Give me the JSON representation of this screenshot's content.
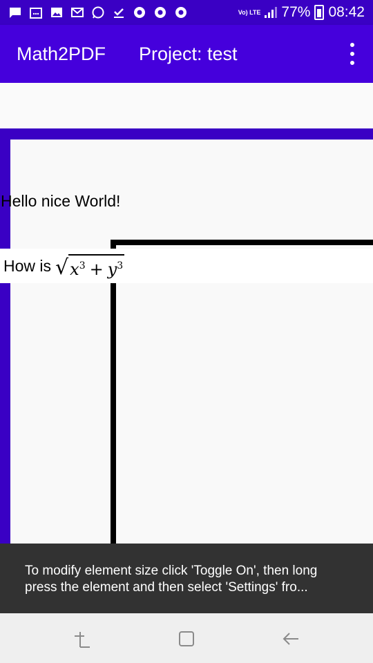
{
  "status_bar": {
    "network_label": "Vo) LTE",
    "battery_percent": "77%",
    "time": "08:42",
    "icons": [
      "chat-icon",
      "calendar-icon",
      "image-icon",
      "gmail-icon",
      "whatsapp-icon",
      "download-done-icon",
      "chrome-icon",
      "chrome-icon",
      "chrome-icon"
    ]
  },
  "app_bar": {
    "app_name": "Math2PDF",
    "project_title": "Project: test",
    "menu_icon": "more-vert-icon"
  },
  "canvas": {
    "text_element": "Hello nice World!",
    "math_element": {
      "prefix": "How is",
      "latex": "\\sqrt{x^3 + y^3}",
      "base1": "x",
      "exp1": "3",
      "op": "+",
      "base2": "y",
      "exp2": "3"
    }
  },
  "snackbar": {
    "message": "To modify element size click 'Toggle On', then long press the  element and then select 'Settings' fro..."
  },
  "nav_bar": {
    "buttons": [
      "recent-apps-icon",
      "home-icon",
      "back-icon"
    ]
  },
  "colors": {
    "status_bar": "#3a00c4",
    "app_bar": "#4500dc",
    "frame": "#3a00c4",
    "snackbar": "#323232"
  }
}
